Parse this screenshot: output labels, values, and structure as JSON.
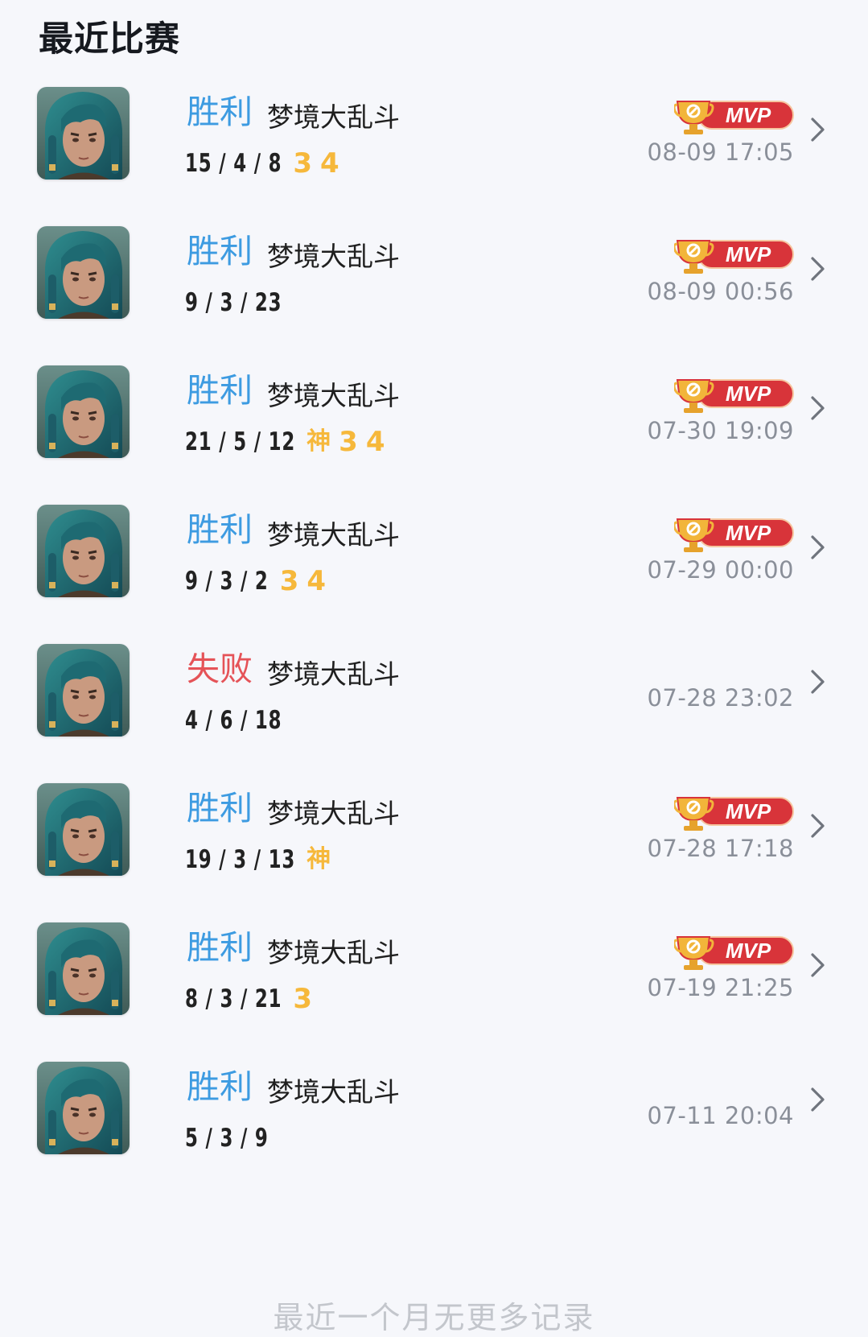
{
  "header": {
    "title": "最近比赛"
  },
  "colors": {
    "win": "#3d9be1",
    "lose": "#e55358",
    "tag": "#f6b83b",
    "mvp_badge": "#d8343a",
    "time": "#8a8f99"
  },
  "matches": [
    {
      "result": "胜利",
      "outcome": "win",
      "mode": "梦境大乱斗",
      "kda": "15 / 4 / 8",
      "tags": [
        "3",
        "4"
      ],
      "mvp": true,
      "time": "08-09 17:05"
    },
    {
      "result": "胜利",
      "outcome": "win",
      "mode": "梦境大乱斗",
      "kda": "9 / 3 / 23",
      "tags": [],
      "mvp": true,
      "time": "08-09 00:56"
    },
    {
      "result": "胜利",
      "outcome": "win",
      "mode": "梦境大乱斗",
      "kda": "21 / 5 / 12",
      "tags": [
        "神",
        "3",
        "4"
      ],
      "mvp": true,
      "time": "07-30 19:09"
    },
    {
      "result": "胜利",
      "outcome": "win",
      "mode": "梦境大乱斗",
      "kda": "9 / 3 / 2",
      "tags": [
        "3",
        "4"
      ],
      "mvp": true,
      "time": "07-29 00:00"
    },
    {
      "result": "失败",
      "outcome": "lose",
      "mode": "梦境大乱斗",
      "kda": "4 / 6 / 18",
      "tags": [],
      "mvp": false,
      "time": "07-28 23:02"
    },
    {
      "result": "胜利",
      "outcome": "win",
      "mode": "梦境大乱斗",
      "kda": "19 / 3 / 13",
      "tags": [
        "神"
      ],
      "mvp": true,
      "time": "07-28 17:18"
    },
    {
      "result": "胜利",
      "outcome": "win",
      "mode": "梦境大乱斗",
      "kda": "8 / 3 / 21",
      "tags": [
        "3"
      ],
      "mvp": true,
      "time": "07-19 21:25"
    },
    {
      "result": "胜利",
      "outcome": "win",
      "mode": "梦境大乱斗",
      "kda": "5 / 3 / 9",
      "tags": [],
      "mvp": false,
      "time": "07-11 20:04"
    }
  ],
  "mvp_label": "MVP",
  "icons": {
    "avatar": "hero-portrait-icon",
    "mvp": "trophy-mvp-icon",
    "chevron": "chevron-right-icon"
  },
  "footer": {
    "text": "最近一个月无更多记录"
  }
}
